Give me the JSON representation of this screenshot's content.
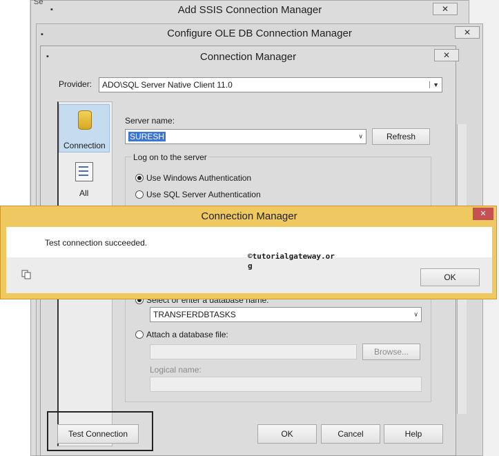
{
  "ssis_window": {
    "title": "Add SSIS Connection Manager",
    "close": "✕",
    "side_text": "Se"
  },
  "oledb_window": {
    "title": "Configure OLE DB Connection Manager",
    "close": "✕"
  },
  "conn_window": {
    "title": "Connection Manager",
    "close": "✕",
    "provider_label": "Provider:",
    "provider_value": "ADO\\SQL Server Native Client 11.0",
    "nav": [
      {
        "label": "Connection",
        "icon": "database-icon"
      },
      {
        "label": "All",
        "icon": "properties-icon"
      }
    ],
    "server_name_label": "Server name:",
    "server_name_value": "SURESH",
    "refresh_label": "Refresh",
    "logon_group_label": "Log on to the server",
    "auth_windows": "Use Windows Authentication",
    "auth_sql": "Use SQL Server Authentication",
    "db_select_label": "Select or enter a database name:",
    "db_value": "TRANSFERDBTASKS",
    "attach_label": "Attach a database file:",
    "browse_label": "Browse...",
    "logical_name_label": "Logical name:",
    "test_connection_label": "Test Connection",
    "ok_label": "OK",
    "cancel_label": "Cancel",
    "help_label": "Help"
  },
  "message_box": {
    "title": "Connection Manager",
    "close": "✕",
    "message": "Test connection succeeded.",
    "watermark_line1": "©tutorialgateway.or",
    "watermark_line2": "g",
    "ok_label": "OK",
    "copy_icon": "copy-icon"
  },
  "colors": {
    "message_border": "#e8b43c",
    "selected_nav": "#c5dcf0"
  }
}
